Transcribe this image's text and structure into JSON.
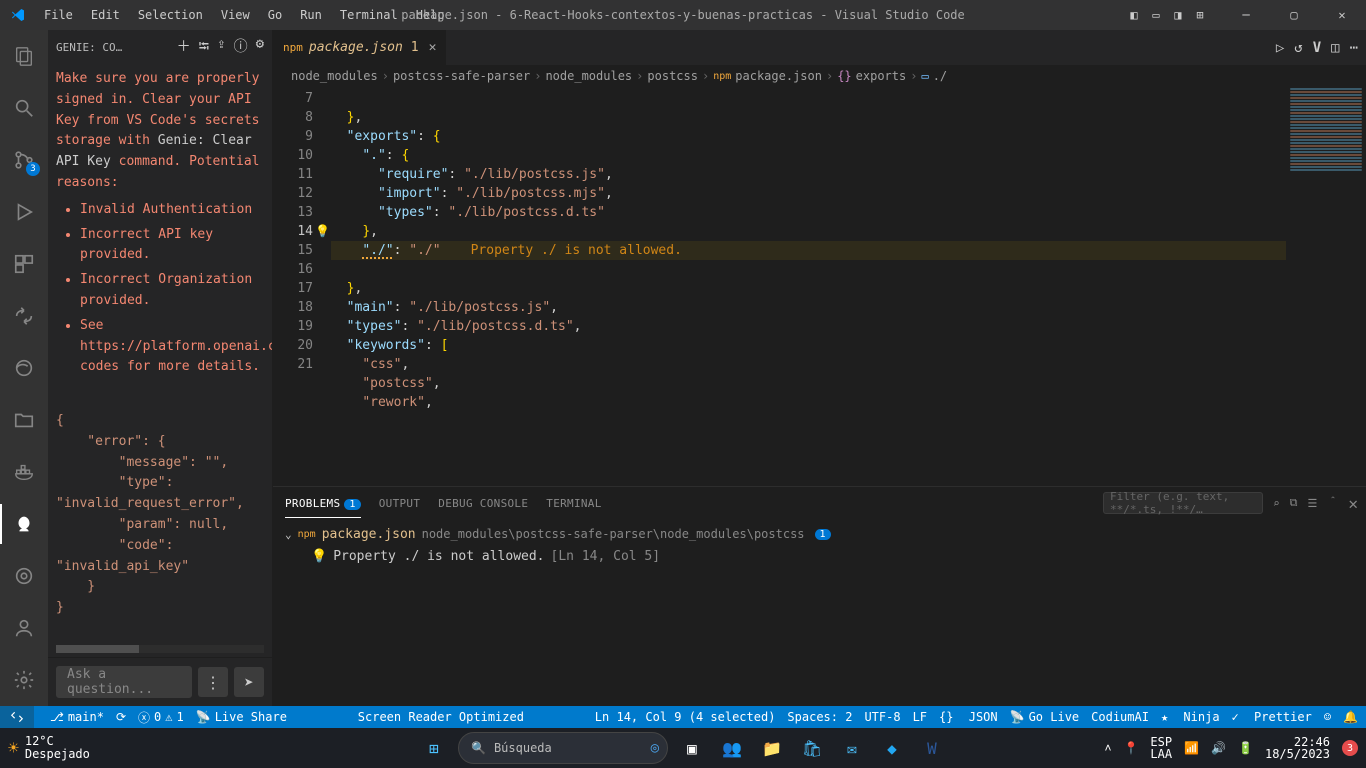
{
  "titlebar": {
    "menus": [
      "File",
      "Edit",
      "Selection",
      "View",
      "Go",
      "Run",
      "Terminal",
      "Help"
    ],
    "title": "package.json - 6-React-Hooks-contextos-y-buenas-practicas - Visual Studio Code"
  },
  "activitybar": {
    "scm_badge": "3"
  },
  "sidebar": {
    "title": "GENIE: CO…",
    "message_pre": "Make sure you are properly signed in. Clear your API Key from VS Code's secrets storage with ",
    "cmd": "Genie: Clear API Key",
    "message_post": " command. Potential reasons:",
    "reasons": [
      "Invalid Authentication",
      "Incorrect API key provided.",
      "Incorrect Organization provided.",
      "See https://platform.openai.co… codes for more details."
    ],
    "json_lines": [
      "{",
      "    \"error\": {",
      "        \"message\": \"\",",
      "        \"type\": ",
      "\"invalid_request_error\",",
      "        \"param\": null,",
      "        \"code\": ",
      "\"invalid_api_key\"",
      "    }",
      "}"
    ],
    "placeholder": "Ask a question..."
  },
  "tab": {
    "filename": "package.json",
    "modified": "1"
  },
  "tabs_actions": {
    "v_label": "V"
  },
  "breadcrumbs": {
    "parts": [
      "node_modules",
      "postcss-safe-parser",
      "node_modules",
      "postcss",
      "package.json",
      "exports",
      "./"
    ]
  },
  "editor": {
    "lines": [
      {
        "n": 7,
        "text": "  },"
      },
      {
        "n": 8,
        "text": "  \"exports\": {"
      },
      {
        "n": 9,
        "text": "    \".\": {"
      },
      {
        "n": 10,
        "text": "      \"require\": \"./lib/postcss.js\","
      },
      {
        "n": 11,
        "text": "      \"import\": \"./lib/postcss.mjs\","
      },
      {
        "n": 12,
        "text": "      \"types\": \"./lib/postcss.d.ts\""
      },
      {
        "n": 13,
        "text": "    },"
      },
      {
        "n": 14,
        "text": "    \"./\": \"./\"",
        "diag": "Property ./ is not allowed."
      },
      {
        "n": 15,
        "text": "  },"
      },
      {
        "n": 16,
        "text": "  \"main\": \"./lib/postcss.js\","
      },
      {
        "n": 17,
        "text": "  \"types\": \"./lib/postcss.d.ts\","
      },
      {
        "n": 18,
        "text": "  \"keywords\": ["
      },
      {
        "n": 19,
        "text": "    \"css\","
      },
      {
        "n": 20,
        "text": "    \"postcss\","
      },
      {
        "n": 21,
        "text": "    \"rework\","
      }
    ]
  },
  "panel": {
    "tabs": {
      "problems": "PROBLEMS",
      "output": "OUTPUT",
      "debug": "DEBUG CONSOLE",
      "terminal": "TERMINAL"
    },
    "badge": "1",
    "filter_placeholder": "Filter (e.g. text, **/*.ts, !**/…",
    "file": {
      "name": "package.json",
      "path": "node_modules\\postcss-safe-parser\\node_modules\\postcss",
      "count": "1"
    },
    "item": {
      "msg": "Property ./ is not allowed.",
      "loc": "[Ln 14, Col 5]"
    }
  },
  "status": {
    "branch": "main*",
    "errwarn_errors": "0",
    "errwarn_warnings": "1",
    "live_share": "Live Share",
    "center": "Screen Reader Optimized",
    "lncol": "Ln 14, Col 9 (4 selected)",
    "spaces": "Spaces: 2",
    "encoding": "UTF-8",
    "eol": "LF",
    "lang": "JSON",
    "golive": "Go Live",
    "codium": "CodiumAI",
    "ninja": "Ninja",
    "prettier": "Prettier"
  },
  "taskbar": {
    "temp": "12°C",
    "weather": "Despejado",
    "search_placeholder": "Búsqueda",
    "lang_top": "ESP",
    "lang_bot": "LAA",
    "time": "22:46",
    "date": "18/5/2023",
    "notif": "3"
  }
}
